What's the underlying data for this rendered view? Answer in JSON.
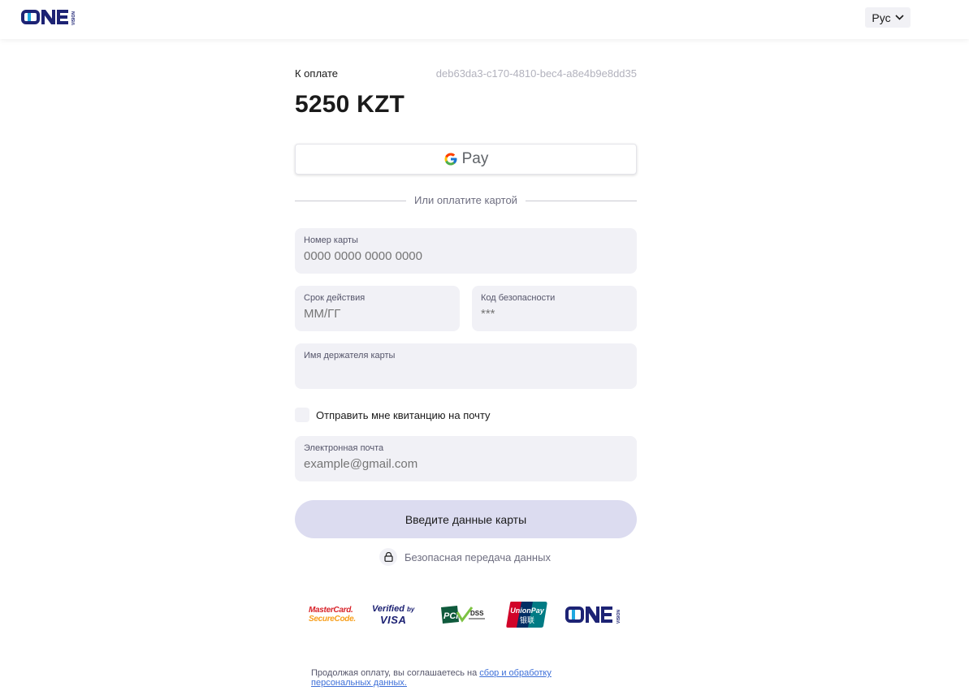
{
  "header": {
    "logo_text": "ONE VISION",
    "language": "Рус"
  },
  "payment": {
    "label": "К оплате",
    "order_id": "deb63da3-c170-4810-bec4-a8e4b9e8dd35",
    "amount": "5250 KZT"
  },
  "gpay": {
    "label": "Pay"
  },
  "divider_text": "Или оплатите картой",
  "form": {
    "card_number": {
      "label": "Номер карты",
      "placeholder": "0000 0000 0000 0000"
    },
    "expiry": {
      "label": "Срок действия",
      "placeholder": "ММ/ГГ"
    },
    "cvv": {
      "label": "Код безопасности",
      "placeholder": "***"
    },
    "holder": {
      "label": "Имя держателя карты",
      "placeholder": ""
    },
    "receipt_checkbox_label": "Отправить мне квитанцию на почту",
    "email": {
      "label": "Электронная почта",
      "placeholder": "example@gmail.com"
    },
    "submit_label": "Введите данные карты"
  },
  "secure_text": "Безопасная передача данных",
  "badges": {
    "mastercard_line1": "MasterCard.",
    "mastercard_line2": "SecureCode.",
    "visa_line1": "Verified",
    "visa_by": "by",
    "visa_line2": "VISA",
    "pci_text": "PCI",
    "pci_dss": "DSS",
    "unionpay_text": "UnionPay",
    "unionpay_cn": "银联",
    "onevision_text": "ONE",
    "onevision_sub": "VISION"
  },
  "footer": {
    "text": "Продолжая оплату, вы соглашаетесь на ",
    "link": "сбор и обработку персональных данных."
  },
  "colors": {
    "brand_navy": "#1d2374",
    "brand_cyan": "#1fa8e0",
    "field_bg": "#f1f1f6",
    "submit_bg": "#dcdcf0"
  }
}
